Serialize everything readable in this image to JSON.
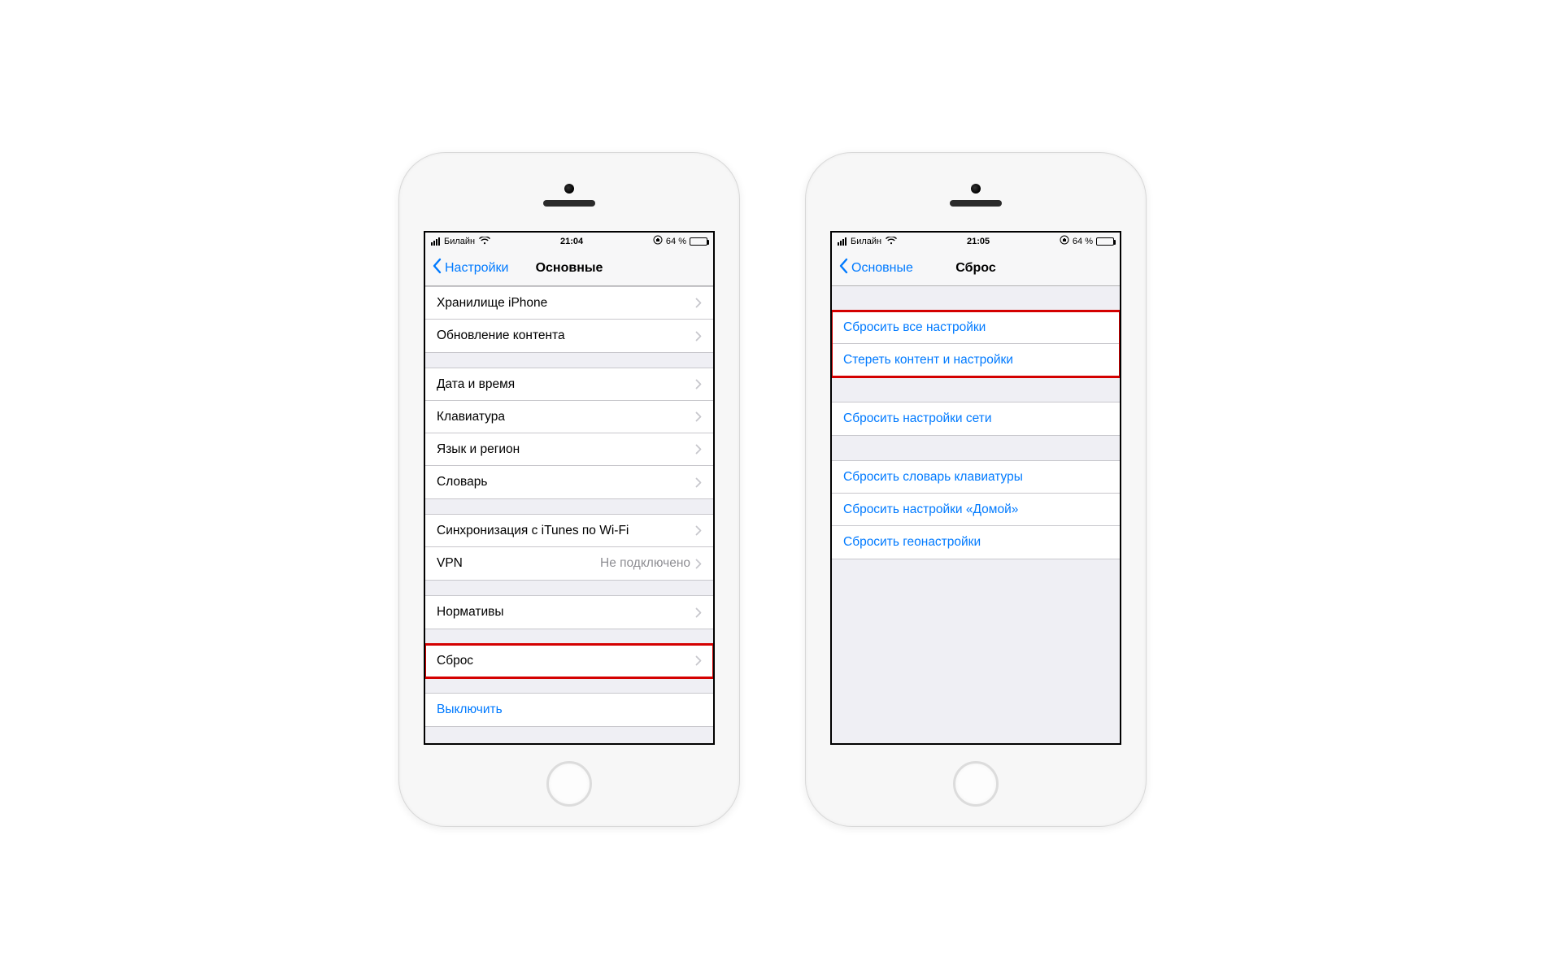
{
  "phone_left": {
    "status": {
      "carrier": "Билайн",
      "time": "21:04",
      "battery_pct": "64 %",
      "battery_fill": 64
    },
    "nav": {
      "back": "Настройки",
      "title": "Основные"
    },
    "groups": [
      {
        "rows": [
          {
            "label": "Хранилище iPhone",
            "chevron": true
          },
          {
            "label": "Обновление контента",
            "chevron": true
          }
        ]
      },
      {
        "rows": [
          {
            "label": "Дата и время",
            "chevron": true
          },
          {
            "label": "Клавиатура",
            "chevron": true
          },
          {
            "label": "Язык и регион",
            "chevron": true
          },
          {
            "label": "Словарь",
            "chevron": true
          }
        ]
      },
      {
        "rows": [
          {
            "label": "Синхронизация с iTunes по Wi-Fi",
            "chevron": true
          },
          {
            "label": "VPN",
            "value": "Не подключено",
            "chevron": true
          }
        ]
      },
      {
        "rows": [
          {
            "label": "Нормативы",
            "chevron": true
          }
        ]
      },
      {
        "rows": [
          {
            "label": "Сброс",
            "chevron": true
          }
        ],
        "highlighted": true
      },
      {
        "rows": [
          {
            "label": "Выключить",
            "link": true
          }
        ]
      }
    ]
  },
  "phone_right": {
    "status": {
      "carrier": "Билайн",
      "time": "21:05",
      "battery_pct": "64 %",
      "battery_fill": 64
    },
    "nav": {
      "back": "Основные",
      "title": "Сброс"
    },
    "groups": [
      {
        "rows": [
          {
            "label": "Сбросить все настройки",
            "link": true
          },
          {
            "label": "Стереть контент и настройки",
            "link": true
          }
        ],
        "highlighted": true,
        "gap": "gap-top-30"
      },
      {
        "rows": [
          {
            "label": "Сбросить настройки сети",
            "link": true
          }
        ],
        "gap": "gap-top-30"
      },
      {
        "rows": [
          {
            "label": "Сбросить словарь клавиатуры",
            "link": true
          },
          {
            "label": "Сбросить настройки «Домой»",
            "link": true
          },
          {
            "label": "Сбросить геонастройки",
            "link": true
          }
        ],
        "gap": "gap-top-30"
      }
    ]
  }
}
